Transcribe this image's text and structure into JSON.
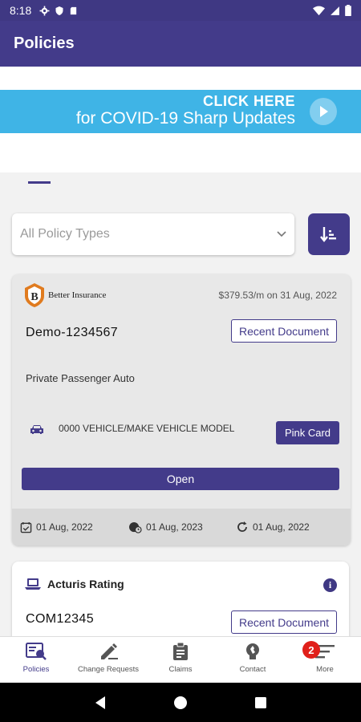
{
  "status_bar": {
    "time": "8:18"
  },
  "app_bar": {
    "title": "Policies"
  },
  "banner": {
    "line1": "CLICK HERE",
    "line2": "for COVID-19 Sharp Updates"
  },
  "filter": {
    "selected": "All Policy Types"
  },
  "policies": [
    {
      "brand": "Better Insurance",
      "price": "$379.53/m on 31 Aug, 2022",
      "policy_number": "Demo-1234567",
      "recent_document_label": "Recent Document",
      "type": "Private Passenger Auto",
      "vehicle": "0000 VEHICLE/MAKE VEHICLE MODEL",
      "pink_card_label": "Pink Card",
      "open_label": "Open",
      "start_date": "01 Aug, 2022",
      "end_date": "01 Aug, 2023",
      "renewal_date": "01 Aug, 2022"
    },
    {
      "name": "Acturis Rating",
      "policy_number": "COM12345",
      "recent_document_label": "Recent Document"
    }
  ],
  "bottom_nav": {
    "items": [
      {
        "label": "Policies",
        "icon": "policies-icon",
        "active": true
      },
      {
        "label": "Change Requests",
        "icon": "pencil-icon"
      },
      {
        "label": "Claims",
        "icon": "clipboard-icon"
      },
      {
        "label": "Contact",
        "icon": "headset-icon"
      },
      {
        "label": "More",
        "icon": "menu-icon",
        "badge": "2"
      }
    ]
  },
  "colors": {
    "primary": "#433b8a",
    "banner": "#3fb4e6",
    "badge": "#e0201a",
    "logo_accent": "#e07b1f"
  }
}
